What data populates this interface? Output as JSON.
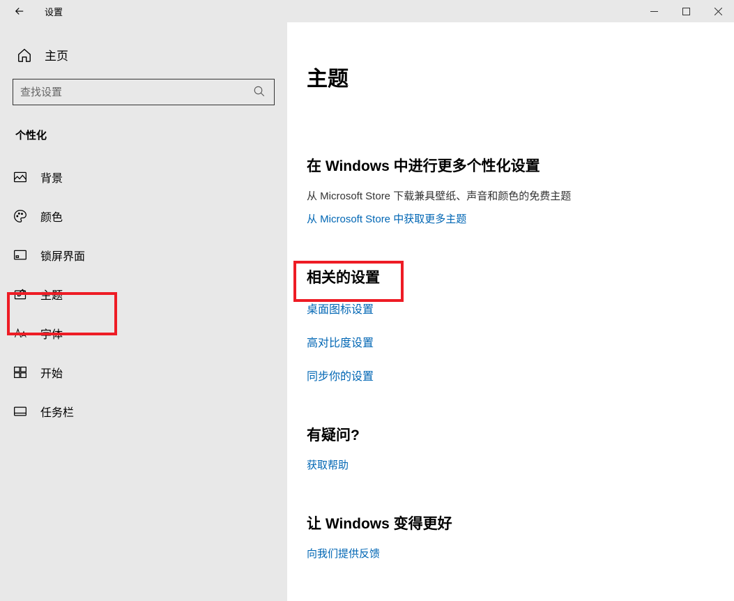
{
  "titlebar": {
    "title": "设置"
  },
  "sidebar": {
    "home_label": "主页",
    "search_placeholder": "查找设置",
    "section_header": "个性化",
    "items": [
      {
        "label": "背景"
      },
      {
        "label": "颜色"
      },
      {
        "label": "锁屏界面"
      },
      {
        "label": "主题"
      },
      {
        "label": "字体"
      },
      {
        "label": "开始"
      },
      {
        "label": "任务栏"
      }
    ]
  },
  "main": {
    "page_title": "主题",
    "group1": {
      "title": "在 Windows 中进行更多个性化设置",
      "desc": "从 Microsoft Store 下载兼具壁纸、声音和颜色的免费主题",
      "link": "从 Microsoft Store 中获取更多主题"
    },
    "group2": {
      "title": "相关的设置",
      "links": [
        "桌面图标设置",
        "高对比度设置",
        "同步你的设置"
      ]
    },
    "group3": {
      "title": "有疑问?",
      "link": "获取帮助"
    },
    "group4": {
      "title": "让 Windows 变得更好",
      "link": "向我们提供反馈"
    }
  }
}
